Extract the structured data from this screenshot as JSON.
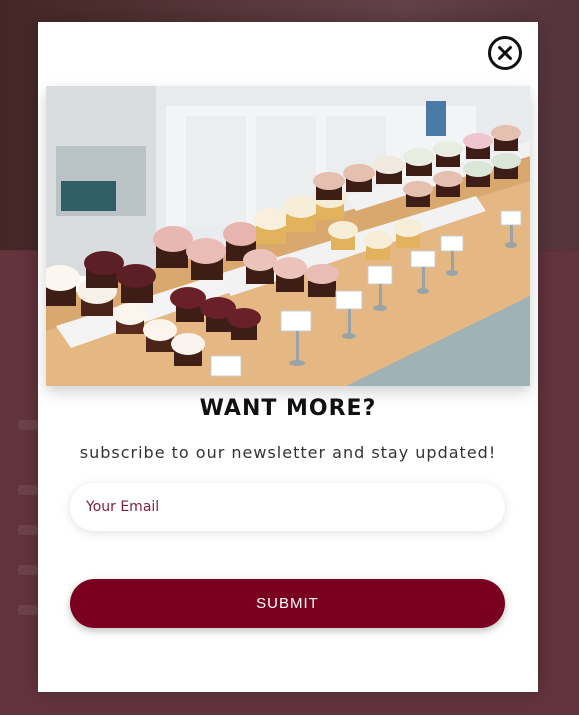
{
  "modal": {
    "close_icon": "close-circle-x-icon",
    "title": "WANT MORE?",
    "subtitle": "subscribe to our newsletter and stay updated!",
    "email": {
      "value": "",
      "placeholder": "Your Email"
    },
    "submit_label": "SUBMIT"
  },
  "colors": {
    "accent": "#7a0020",
    "placeholder": "#7a1f3b",
    "backdrop": "#5a2e35"
  }
}
